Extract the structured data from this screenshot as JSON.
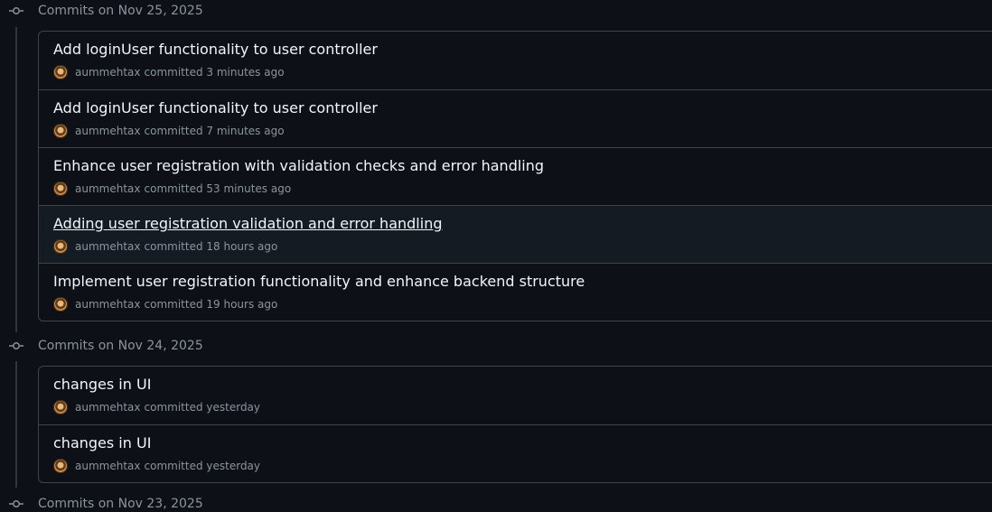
{
  "groups": [
    {
      "title": "Commits on Nov 25, 2025",
      "commits": [
        {
          "message": "Add loginUser functionality to user controller",
          "author": "aummehtax",
          "action": "committed",
          "time": "3 minutes ago"
        },
        {
          "message": "Add loginUser functionality to user controller",
          "author": "aummehtax",
          "action": "committed",
          "time": "7 minutes ago"
        },
        {
          "message": "Enhance user registration with validation checks and error handling",
          "author": "aummehtax",
          "action": "committed",
          "time": "53 minutes ago"
        },
        {
          "message": "Adding user registration validation and error handling",
          "author": "aummehtax",
          "action": "committed",
          "time": "18 hours ago"
        },
        {
          "message": "Implement user registration functionality and enhance backend structure",
          "author": "aummehtax",
          "action": "committed",
          "time": "19 hours ago"
        }
      ]
    },
    {
      "title": "Commits on Nov 24, 2025",
      "commits": [
        {
          "message": "changes in UI",
          "author": "aummehtax",
          "action": "committed",
          "time": "yesterday"
        },
        {
          "message": "changes in UI",
          "author": "aummehtax",
          "action": "committed",
          "time": "yesterday"
        }
      ]
    },
    {
      "title": "Commits on Nov 23, 2025",
      "commits": []
    }
  ],
  "colors": {
    "background": "#0d1117",
    "border": "#3d444d",
    "muted": "#8b949e",
    "text": "#f0f6fc"
  },
  "icons": {
    "group_node": "git-commit-icon",
    "avatar": "user-avatar"
  }
}
